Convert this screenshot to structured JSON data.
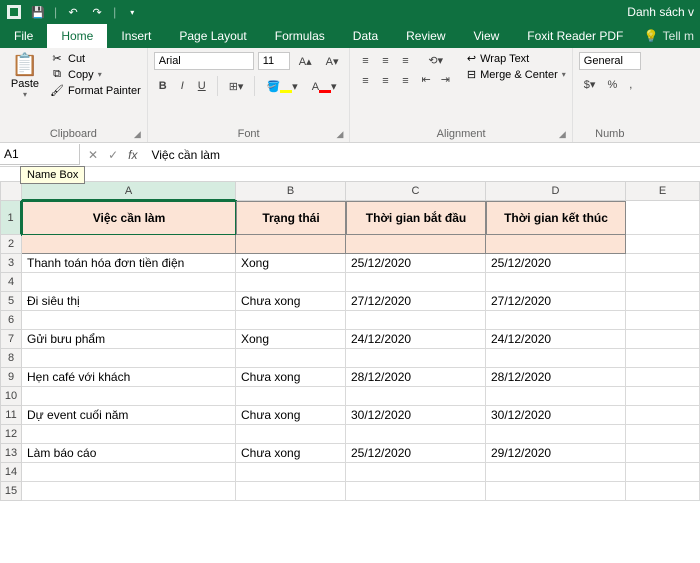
{
  "titlebar": {
    "doc_title": "Danh sách v"
  },
  "tabs": {
    "file": "File",
    "home": "Home",
    "insert": "Insert",
    "page_layout": "Page Layout",
    "formulas": "Formulas",
    "data": "Data",
    "review": "Review",
    "view": "View",
    "foxit": "Foxit Reader PDF",
    "tell": "Tell m"
  },
  "ribbon": {
    "clipboard": {
      "title": "Clipboard",
      "paste": "Paste",
      "cut": "Cut",
      "copy": "Copy",
      "format_painter": "Format Painter"
    },
    "font": {
      "title": "Font",
      "name": "Arial",
      "size": "11"
    },
    "alignment": {
      "title": "Alignment",
      "wrap": "Wrap Text",
      "merge": "Merge & Center"
    },
    "number": {
      "title": "Numb",
      "format": "General"
    }
  },
  "namebox": {
    "value": "A1",
    "tooltip": "Name Box"
  },
  "formula": {
    "value": "Việc cần làm"
  },
  "columns": {
    "A": "A",
    "B": "B",
    "C": "C",
    "D": "D",
    "E": "E"
  },
  "col_widths": {
    "A": 214,
    "B": 110,
    "C": 140,
    "D": 140,
    "E": 74
  },
  "headers": {
    "A": "Việc cần làm",
    "B": "Trạng thái",
    "C": "Thời gian bắt đầu",
    "D": "Thời gian kết thúc"
  },
  "rows": [
    {
      "n": 1
    },
    {
      "n": 2
    },
    {
      "n": 3,
      "A": "Thanh toán hóa đơn tiền điện",
      "B": "Xong",
      "C": "25/12/2020",
      "D": "25/12/2020"
    },
    {
      "n": 4
    },
    {
      "n": 5,
      "A": "Đi siêu thị",
      "B": "Chưa xong",
      "C": "27/12/2020",
      "D": "27/12/2020"
    },
    {
      "n": 6
    },
    {
      "n": 7,
      "A": "Gửi bưu phẩm",
      "B": "Xong",
      "C": "24/12/2020",
      "D": "24/12/2020"
    },
    {
      "n": 8
    },
    {
      "n": 9,
      "A": "Hẹn café với khách",
      "B": "Chưa xong",
      "C": "28/12/2020",
      "D": "28/12/2020"
    },
    {
      "n": 10
    },
    {
      "n": 11,
      "A": "Dự event cuối năm",
      "B": "Chưa xong",
      "C": "30/12/2020",
      "D": "30/12/2020"
    },
    {
      "n": 12
    },
    {
      "n": 13,
      "A": "Làm báo cáo",
      "B": "Chưa xong",
      "C": "25/12/2020",
      "D": "29/12/2020"
    },
    {
      "n": 14
    },
    {
      "n": 15
    }
  ]
}
